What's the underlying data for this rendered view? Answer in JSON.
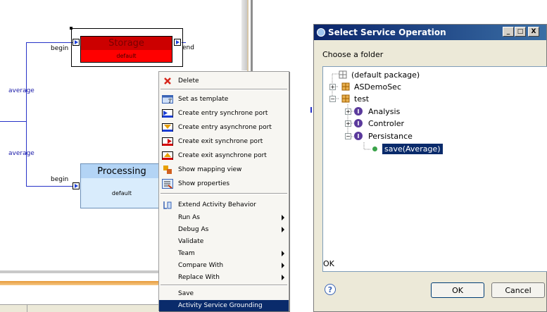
{
  "diagram": {
    "storage": {
      "title": "Storage",
      "body": "default",
      "in_label": "begin",
      "out_label": "end"
    },
    "processing": {
      "title": "Processing",
      "body": "default",
      "in_label": "begin"
    },
    "edge_labels": [
      "average",
      "average"
    ]
  },
  "context_menu": {
    "items": [
      {
        "label": "Delete",
        "icon": "delete-icon"
      },
      {
        "label": "Set as template",
        "icon": "template-icon"
      },
      {
        "label": "Create entry synchrone port",
        "icon": "entry-sync-port-icon"
      },
      {
        "label": "Create entry asynchrone port",
        "icon": "entry-async-port-icon"
      },
      {
        "label": "Create exit synchrone port",
        "icon": "exit-sync-port-icon"
      },
      {
        "label": "Create exit asynchrone port",
        "icon": "exit-async-port-icon"
      },
      {
        "label": "Show mapping view",
        "icon": "mapping-view-icon"
      },
      {
        "label": "Show properties",
        "icon": "properties-icon"
      },
      {
        "label": "Extend Activity Behavior",
        "icon": "extend-behavior-icon"
      },
      {
        "label": "Run As",
        "submenu": true
      },
      {
        "label": "Debug As",
        "submenu": true
      },
      {
        "label": "Validate"
      },
      {
        "label": "Team",
        "submenu": true
      },
      {
        "label": "Compare With",
        "submenu": true
      },
      {
        "label": "Replace With",
        "submenu": true
      },
      {
        "label": "Save"
      },
      {
        "label": "Activity Service Grounding",
        "selected": true
      }
    ]
  },
  "dialog": {
    "title": "Select Service Operation",
    "window_buttons": [
      "_",
      "□",
      "X"
    ],
    "prompt": "Choose a folder",
    "tree": [
      {
        "label": "(default package)"
      },
      {
        "label": "ASDemoSec"
      },
      {
        "label": "test"
      },
      {
        "label": "Analysis"
      },
      {
        "label": "Controler"
      },
      {
        "label": "Persistance"
      },
      {
        "label": "save(Average)",
        "selected": true
      }
    ],
    "status": "OK",
    "ok_label": "OK",
    "cancel_label": "Cancel",
    "help_icon": "help-icon"
  },
  "colors": {
    "storage_head": "#cc0000",
    "storage_body": "#ff0000",
    "processing_head": "#b3d4f5",
    "processing_body": "#d9ecfc",
    "selection": "#0a2b6b"
  }
}
